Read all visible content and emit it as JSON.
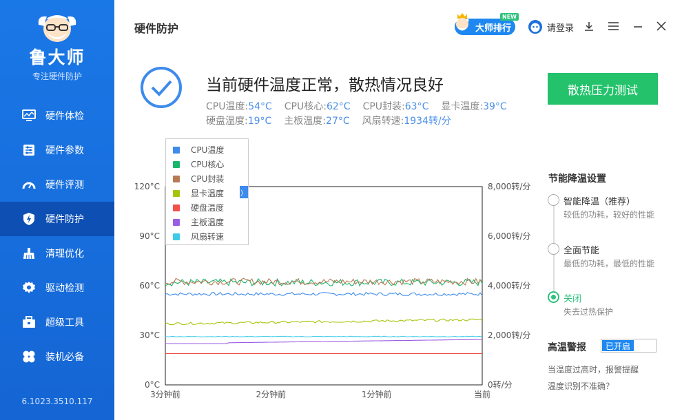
{
  "sidebar": {
    "brand": "鲁大师",
    "slogan": "专注硬件防护",
    "version": "6.1023.3510.117",
    "items": [
      {
        "label": "硬件体检",
        "icon": "monitor-icon",
        "active": false
      },
      {
        "label": "硬件参数",
        "icon": "sliders-icon",
        "active": false
      },
      {
        "label": "硬件评测",
        "icon": "gauge-icon",
        "active": false
      },
      {
        "label": "硬件防护",
        "icon": "shield-bolt-icon",
        "active": true
      },
      {
        "label": "清理优化",
        "icon": "broom-icon",
        "active": false
      },
      {
        "label": "驱动检测",
        "icon": "gear-icon",
        "active": false
      },
      {
        "label": "超级工具",
        "icon": "toolbox-icon",
        "active": false
      },
      {
        "label": "装机必备",
        "icon": "clover-icon",
        "active": false
      }
    ]
  },
  "header": {
    "title": "硬件防护",
    "rank_label": "大师排行",
    "new_badge": "NEW",
    "login_label": "请登录"
  },
  "status": {
    "title": "当前硬件温度正常，散热情况良好",
    "stress_button": "散热压力测试",
    "row1": [
      {
        "label": "CPU温度:",
        "value": "54°C"
      },
      {
        "label": "CPU核心:",
        "value": "62°C"
      },
      {
        "label": "CPU封装:",
        "value": "63°C"
      },
      {
        "label": "显卡温度:",
        "value": "39°C"
      }
    ],
    "row2": [
      {
        "label": "硬盘温度:",
        "value": "19°C"
      },
      {
        "label": "主板温度:",
        "value": "27°C"
      },
      {
        "label": "风扇转速:",
        "value": "1934转/分"
      }
    ]
  },
  "chart_data": {
    "type": "line",
    "x_ticks": [
      "3分钟前",
      "2分钟前",
      "1分钟前",
      "当前"
    ],
    "y_left_ticks": [
      "0°C",
      "30°C",
      "60°C",
      "90°C",
      "120°C"
    ],
    "y_right_ticks": [
      "0转/分",
      "2,000转/分",
      "4,000转/分",
      "6,000转/分",
      "8,000转/分"
    ],
    "ylim_left": [
      0,
      120
    ],
    "ylim_right": [
      0,
      8000
    ],
    "series": [
      {
        "name": "CPU温度",
        "color": "#3d8bec",
        "axis": "left",
        "base": 55,
        "jitter": 1.0,
        "trend": 0
      },
      {
        "name": "CPU核心",
        "color": "#19b56b",
        "axis": "left",
        "base": 62,
        "jitter": 2.2,
        "trend": 0
      },
      {
        "name": "CPU封装",
        "color": "#b87a55",
        "axis": "left",
        "base": 62.5,
        "jitter": 2.0,
        "trend": 0
      },
      {
        "name": "显卡温度",
        "color": "#a8c40a",
        "axis": "left",
        "base": 37,
        "jitter": 0.7,
        "trend": 2.5
      },
      {
        "name": "硬盘温度",
        "color": "#f2504b",
        "axis": "left",
        "base": 19,
        "jitter": 0,
        "trend": 0
      },
      {
        "name": "主板温度",
        "color": "#9b5de5",
        "axis": "left",
        "base": 25,
        "jitter": 0,
        "trend": 2.5
      },
      {
        "name": "风扇转速",
        "color": "#3ecbe8",
        "axis": "right",
        "base": 1950,
        "jitter": 15,
        "trend": 0
      }
    ]
  },
  "legend_toggle": "〉",
  "power_settings": {
    "title": "节能降温设置",
    "options": [
      {
        "label": "智能降温（推荐）",
        "desc": "较低的功耗，较好的性能",
        "selected": false
      },
      {
        "label": "全面节能",
        "desc": "最低的功耗，最低的性能",
        "selected": false
      },
      {
        "label": "关闭",
        "desc": "失去过热保护",
        "selected": true
      }
    ]
  },
  "alarm": {
    "title": "高温警报",
    "toggle_label": "已开启",
    "desc": "当温度过高时，报警提醒",
    "link": "温度识别不准确？"
  }
}
